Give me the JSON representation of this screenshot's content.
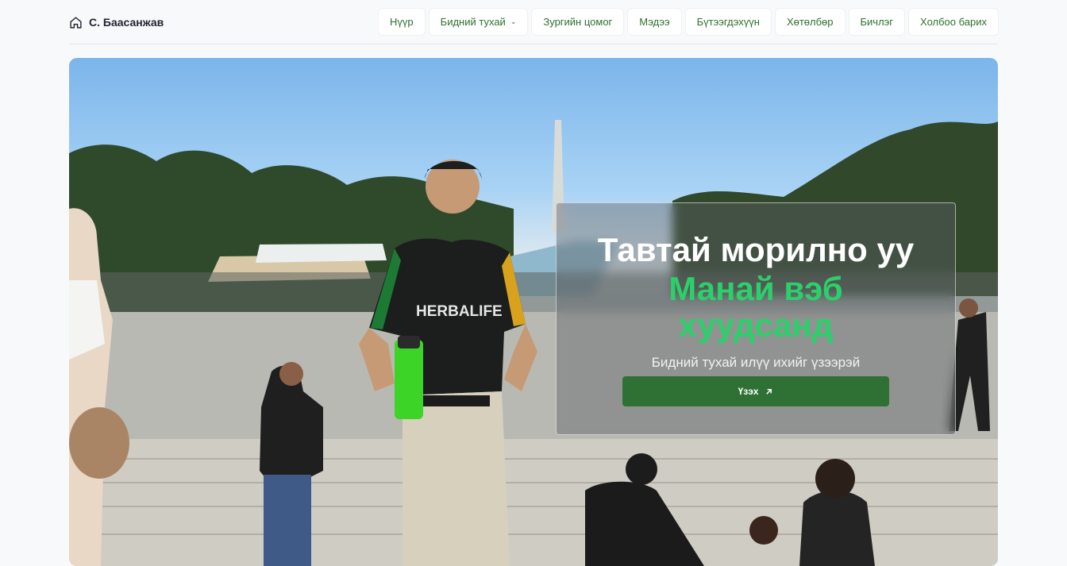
{
  "brand": {
    "name": "С. Баасанжав",
    "icon": "home-icon"
  },
  "nav": {
    "items": [
      {
        "label": "Нүүр"
      },
      {
        "label": "Бидний тухай",
        "has_dropdown": true
      },
      {
        "label": "Зургийн цомог"
      },
      {
        "label": "Мэдээ"
      },
      {
        "label": "Бүтээгдэхүүн"
      },
      {
        "label": "Хөтөлбөр"
      },
      {
        "label": "Бичлэг"
      },
      {
        "label": "Холбоо барих"
      }
    ]
  },
  "hero": {
    "title": "Тавтай морилно уу",
    "accent": "Манай вэб хуудсанд",
    "subtitle": "Бидний тухай илүү ихийг үзээрэй",
    "button_label": "Үзэх",
    "button_icon": "arrow-up-right-icon",
    "shirt_text": "HERBALIFE"
  },
  "colors": {
    "accent_green": "#2bd06b",
    "button_green": "#2f7135",
    "nav_text": "#2e6f31"
  }
}
